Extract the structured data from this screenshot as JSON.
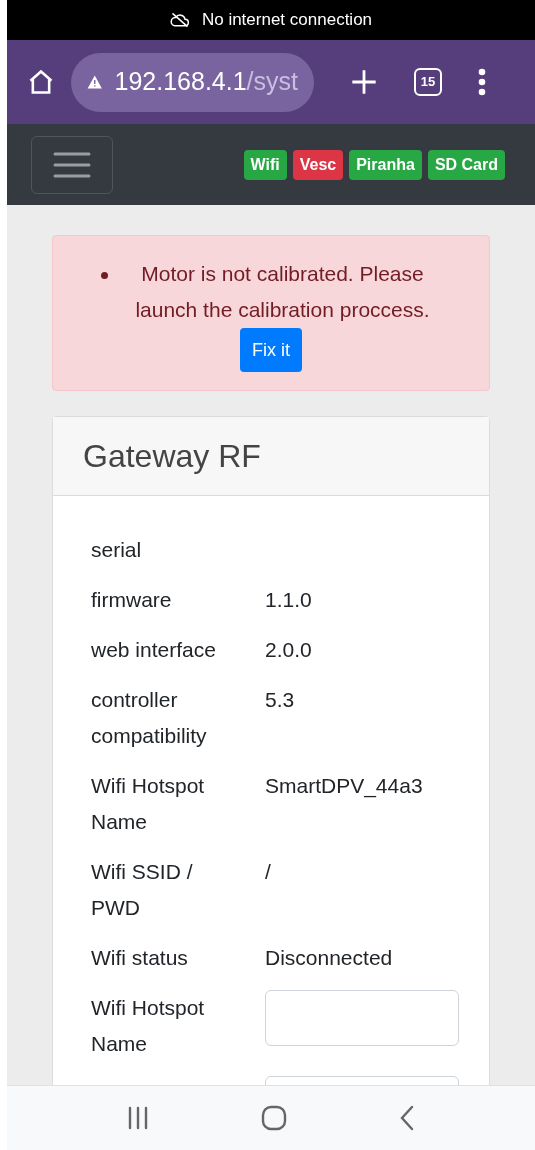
{
  "status_bar": {
    "text": "No internet connection"
  },
  "browser": {
    "url_host": "192.168.4.1",
    "url_path": "/syst",
    "tab_count": "15"
  },
  "navbar": {
    "badges": [
      {
        "label": "Wifi",
        "color": "#28a745"
      },
      {
        "label": "Vesc",
        "color": "#dc3545"
      },
      {
        "label": "Piranha",
        "color": "#28a745"
      },
      {
        "label": "SD Card",
        "color": "#28a745"
      }
    ]
  },
  "alert": {
    "message": "Motor is not calibrated. Please launch the calibration proccess.",
    "button": "Fix it"
  },
  "card": {
    "title": "Gateway RF",
    "rows": [
      {
        "kind": "text",
        "label": "serial"
      },
      {
        "kind": "text",
        "label": "firmware",
        "value": "1.1.0"
      },
      {
        "kind": "text",
        "label": "web interface",
        "value": "2.0.0"
      },
      {
        "kind": "text",
        "label": "controller compatibility",
        "value": "5.3"
      },
      {
        "kind": "text",
        "label": "Wifi Hotspot Name",
        "value": "SmartDPV_44a3"
      },
      {
        "kind": "text",
        "label": "Wifi SSID / PWD",
        "value": "/"
      },
      {
        "kind": "text",
        "label": "Wifi status",
        "value": "Disconnected"
      },
      {
        "kind": "input",
        "label": "Wifi Hotspot Name"
      },
      {
        "kind": "input"
      }
    ]
  }
}
